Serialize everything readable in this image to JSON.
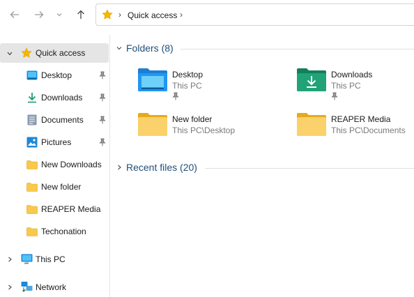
{
  "address": {
    "crumbs": [
      "Quick access"
    ]
  },
  "sidebar": {
    "quick_access": "Quick access",
    "pinned": [
      {
        "label": "Desktop",
        "icon": "desktop-icon"
      },
      {
        "label": "Downloads",
        "icon": "download-icon"
      },
      {
        "label": "Documents",
        "icon": "document-icon"
      },
      {
        "label": "Pictures",
        "icon": "picture-icon"
      }
    ],
    "folders": [
      {
        "label": "New Downloads"
      },
      {
        "label": "New folder"
      },
      {
        "label": "REAPER Media"
      },
      {
        "label": "Techonation"
      }
    ],
    "this_pc": "This PC",
    "network": "Network"
  },
  "main": {
    "folders_heading": "Folders (8)",
    "recent_heading": "Recent files (20)",
    "folders": [
      {
        "name": "Desktop",
        "location": "This PC",
        "pinned": true,
        "icon": "desktop-folder-icon"
      },
      {
        "name": "Downloads",
        "location": "This PC",
        "pinned": true,
        "icon": "downloads-folder-icon"
      },
      {
        "name": "New folder",
        "location": "This PC\\Desktop",
        "pinned": false,
        "icon": "folder-icon"
      },
      {
        "name": "REAPER Media",
        "location": "This PC\\Documents",
        "pinned": false,
        "icon": "folder-icon"
      }
    ]
  },
  "colors": {
    "accent_heading": "#1f4e79",
    "folder_yellow": "#f8c94a",
    "selected_bg": "#e5e5e5"
  }
}
